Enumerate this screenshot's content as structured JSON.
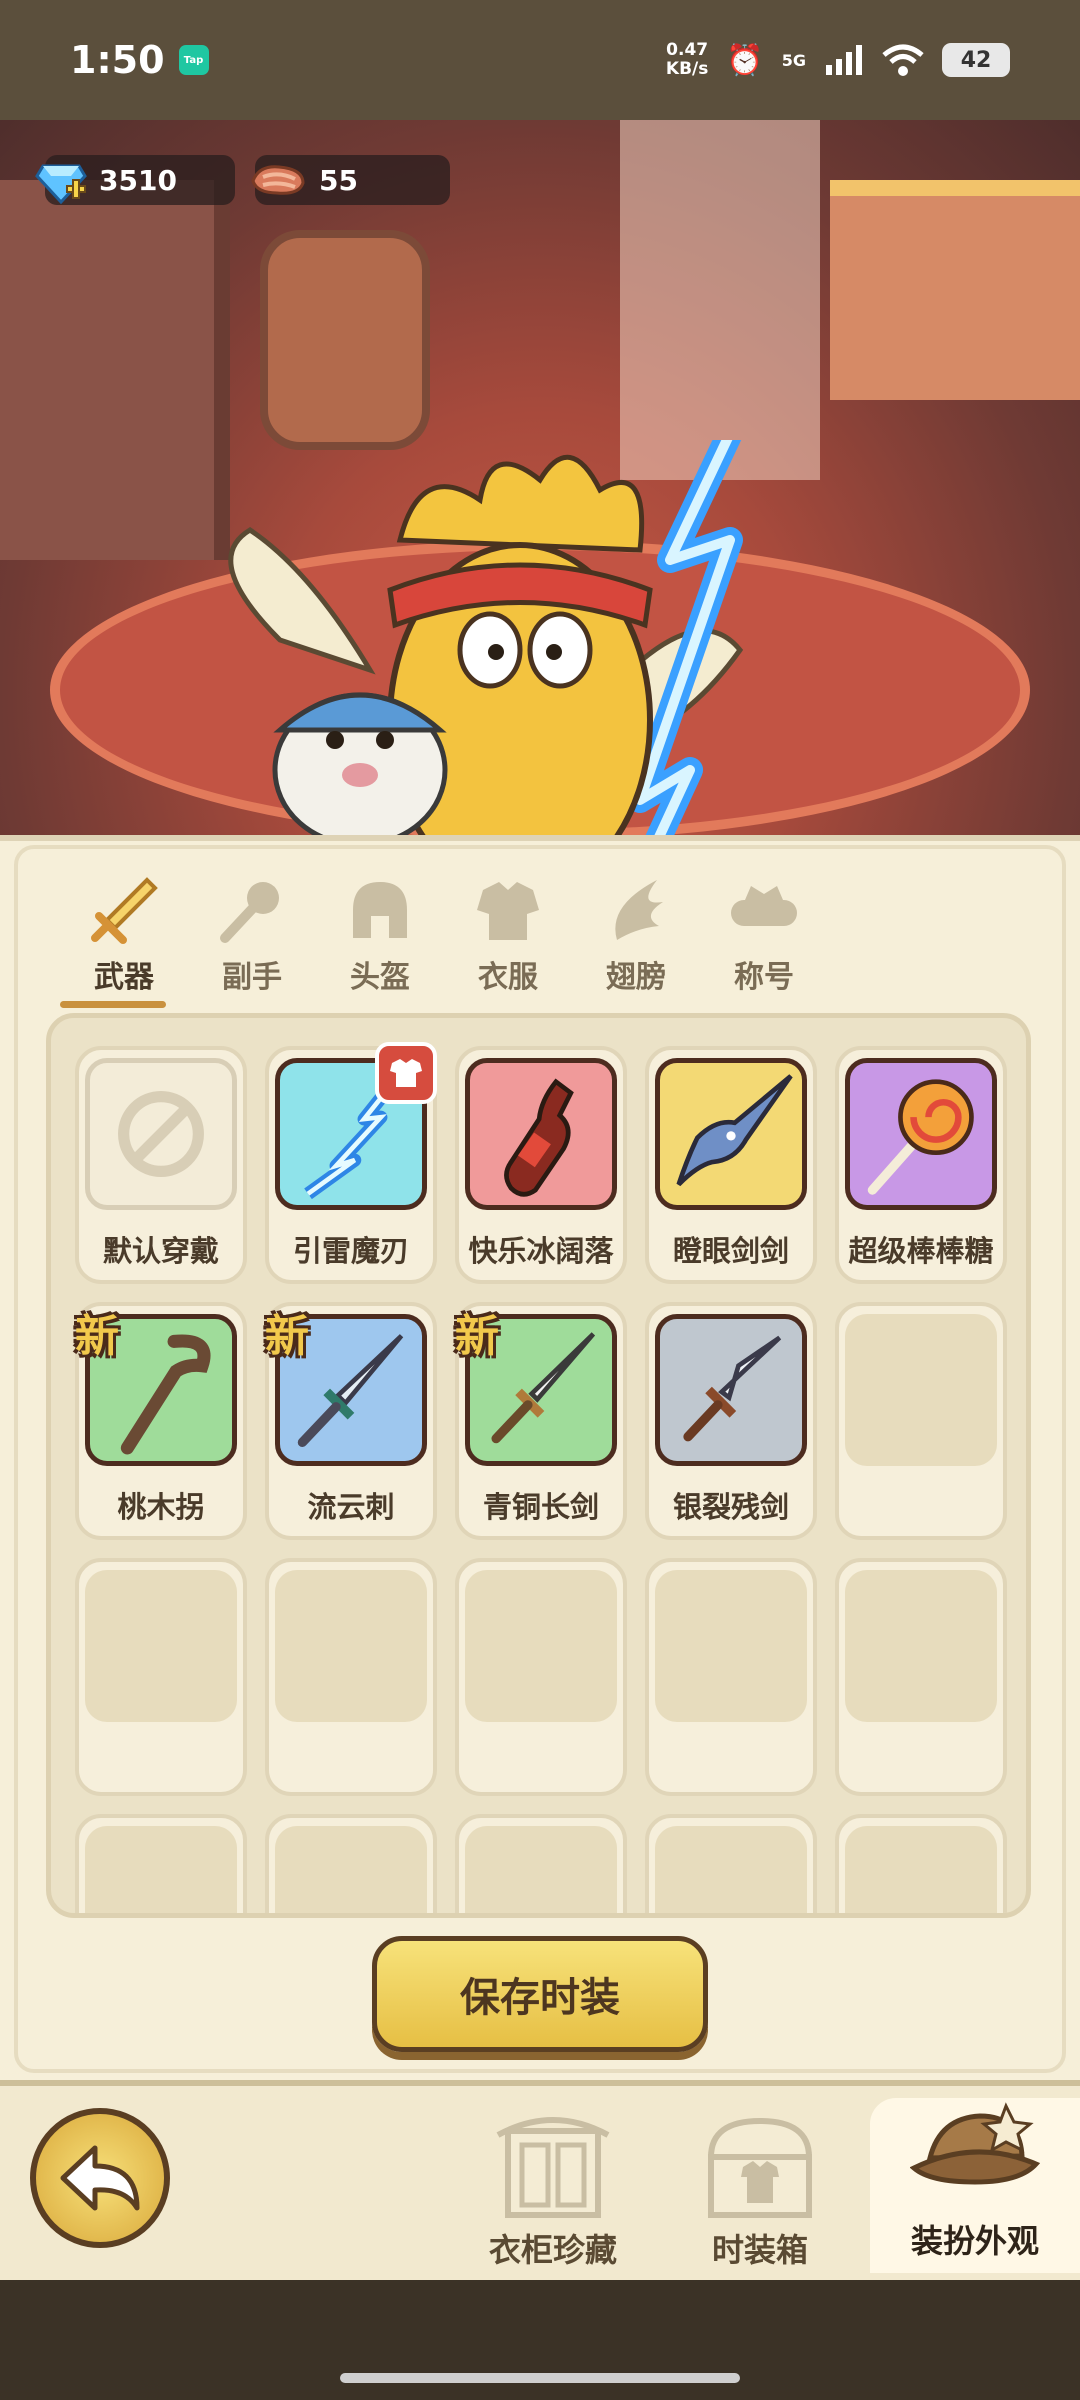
{
  "status_bar": {
    "time": "1:50",
    "app_badge": "Tap",
    "net_speed_value": "0.47",
    "net_speed_unit": "KB/s",
    "network": "5G",
    "battery": "42"
  },
  "currencies": {
    "gems": "3510",
    "meat": "55"
  },
  "tabs": [
    {
      "label": "武器",
      "active": true
    },
    {
      "label": "副手",
      "active": false
    },
    {
      "label": "头盔",
      "active": false
    },
    {
      "label": "衣服",
      "active": false
    },
    {
      "label": "翅膀",
      "active": false
    },
    {
      "label": "称号",
      "active": false
    }
  ],
  "items": [
    {
      "name": "默认穿戴",
      "new": false,
      "color": "#f3ecd8"
    },
    {
      "name": "引雷魔刃",
      "new": false,
      "color": "#8fe3ea"
    },
    {
      "name": "快乐冰阔落",
      "new": false,
      "color": "#f09a9a"
    },
    {
      "name": "瞪眼剑剑",
      "new": false,
      "color": "#f3d974"
    },
    {
      "name": "超级棒棒糖",
      "new": false,
      "color": "#c898e6"
    },
    {
      "name": "桃木拐",
      "new": true,
      "color": "#9fdc9a"
    },
    {
      "name": "流云刺",
      "new": true,
      "color": "#9ec7ee"
    },
    {
      "name": "青铜长剑",
      "new": true,
      "color": "#9fdc9a"
    },
    {
      "name": "银裂残剑",
      "new": false,
      "color": "#bfc7cf"
    }
  ],
  "badges": {
    "new_label": "新"
  },
  "actions": {
    "save_label": "保存时装"
  },
  "bottom_nav": {
    "wardrobe_label": "衣柜珍藏",
    "fashion_box_label": "时装箱",
    "dress_up_label": "装扮外观"
  }
}
